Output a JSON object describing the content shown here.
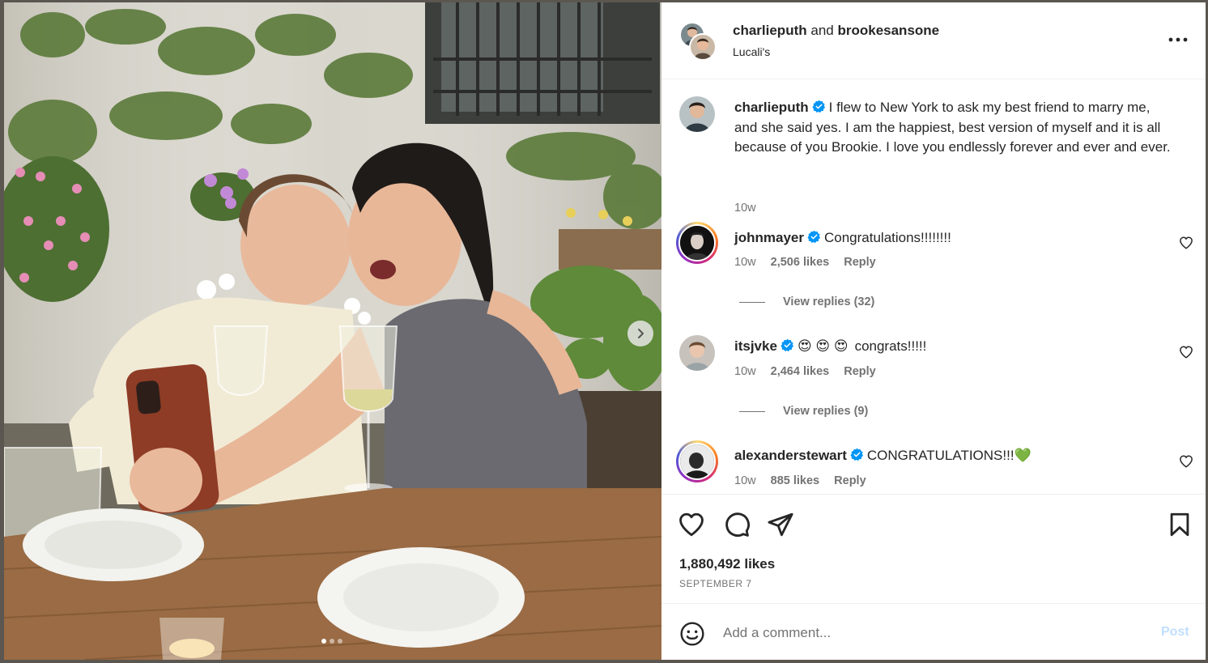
{
  "post": {
    "authors": [
      "charlieputh",
      "brookesansone"
    ],
    "joiner": "and",
    "location": "Lucali's",
    "image_count": 3,
    "active_image": 1
  },
  "caption": {
    "user": "charlieputh",
    "verified": true,
    "text": "I flew to New York to ask my best friend to marry me, and she said yes. I am the happiest, best version of myself and it is all because of you Brookie. I love you endlessly forever and ever and ever.",
    "age": "10w"
  },
  "comments": [
    {
      "user": "johnmayer",
      "verified": true,
      "text": "Congratulations!!!!!!!!",
      "emoji": "",
      "age": "10w",
      "likes": "2,506 likes",
      "reply": "Reply",
      "view_replies": "View replies (32)"
    },
    {
      "user": "itsjvke",
      "verified": true,
      "text": "congrats!!!!!",
      "emoji": "😍 😍 😍",
      "age": "10w",
      "likes": "2,464 likes",
      "reply": "Reply",
      "view_replies": "View replies (9)"
    },
    {
      "user": "alexanderstewart",
      "verified": true,
      "text": "CONGRATULATIONS!!!",
      "emoji": "💚",
      "age": "10w",
      "likes": "885 likes",
      "reply": "Reply",
      "view_replies": ""
    }
  ],
  "stats": {
    "likes": "1,880,492 likes",
    "date": "SEPTEMBER 7"
  },
  "composer": {
    "placeholder": "Add a comment...",
    "post_label": "Post"
  },
  "icons": {
    "more": "more-options-icon",
    "like": "heart-icon",
    "comment": "comment-bubble-icon",
    "share": "paper-plane-icon",
    "save": "bookmark-icon",
    "emoji": "smiley-icon",
    "next": "chevron-right-icon",
    "verified": "verified-badge-icon"
  },
  "colors": {
    "verified": "#0095f6",
    "text": "#262626",
    "secondary": "#737373",
    "post_disabled": "#c0dffd"
  }
}
